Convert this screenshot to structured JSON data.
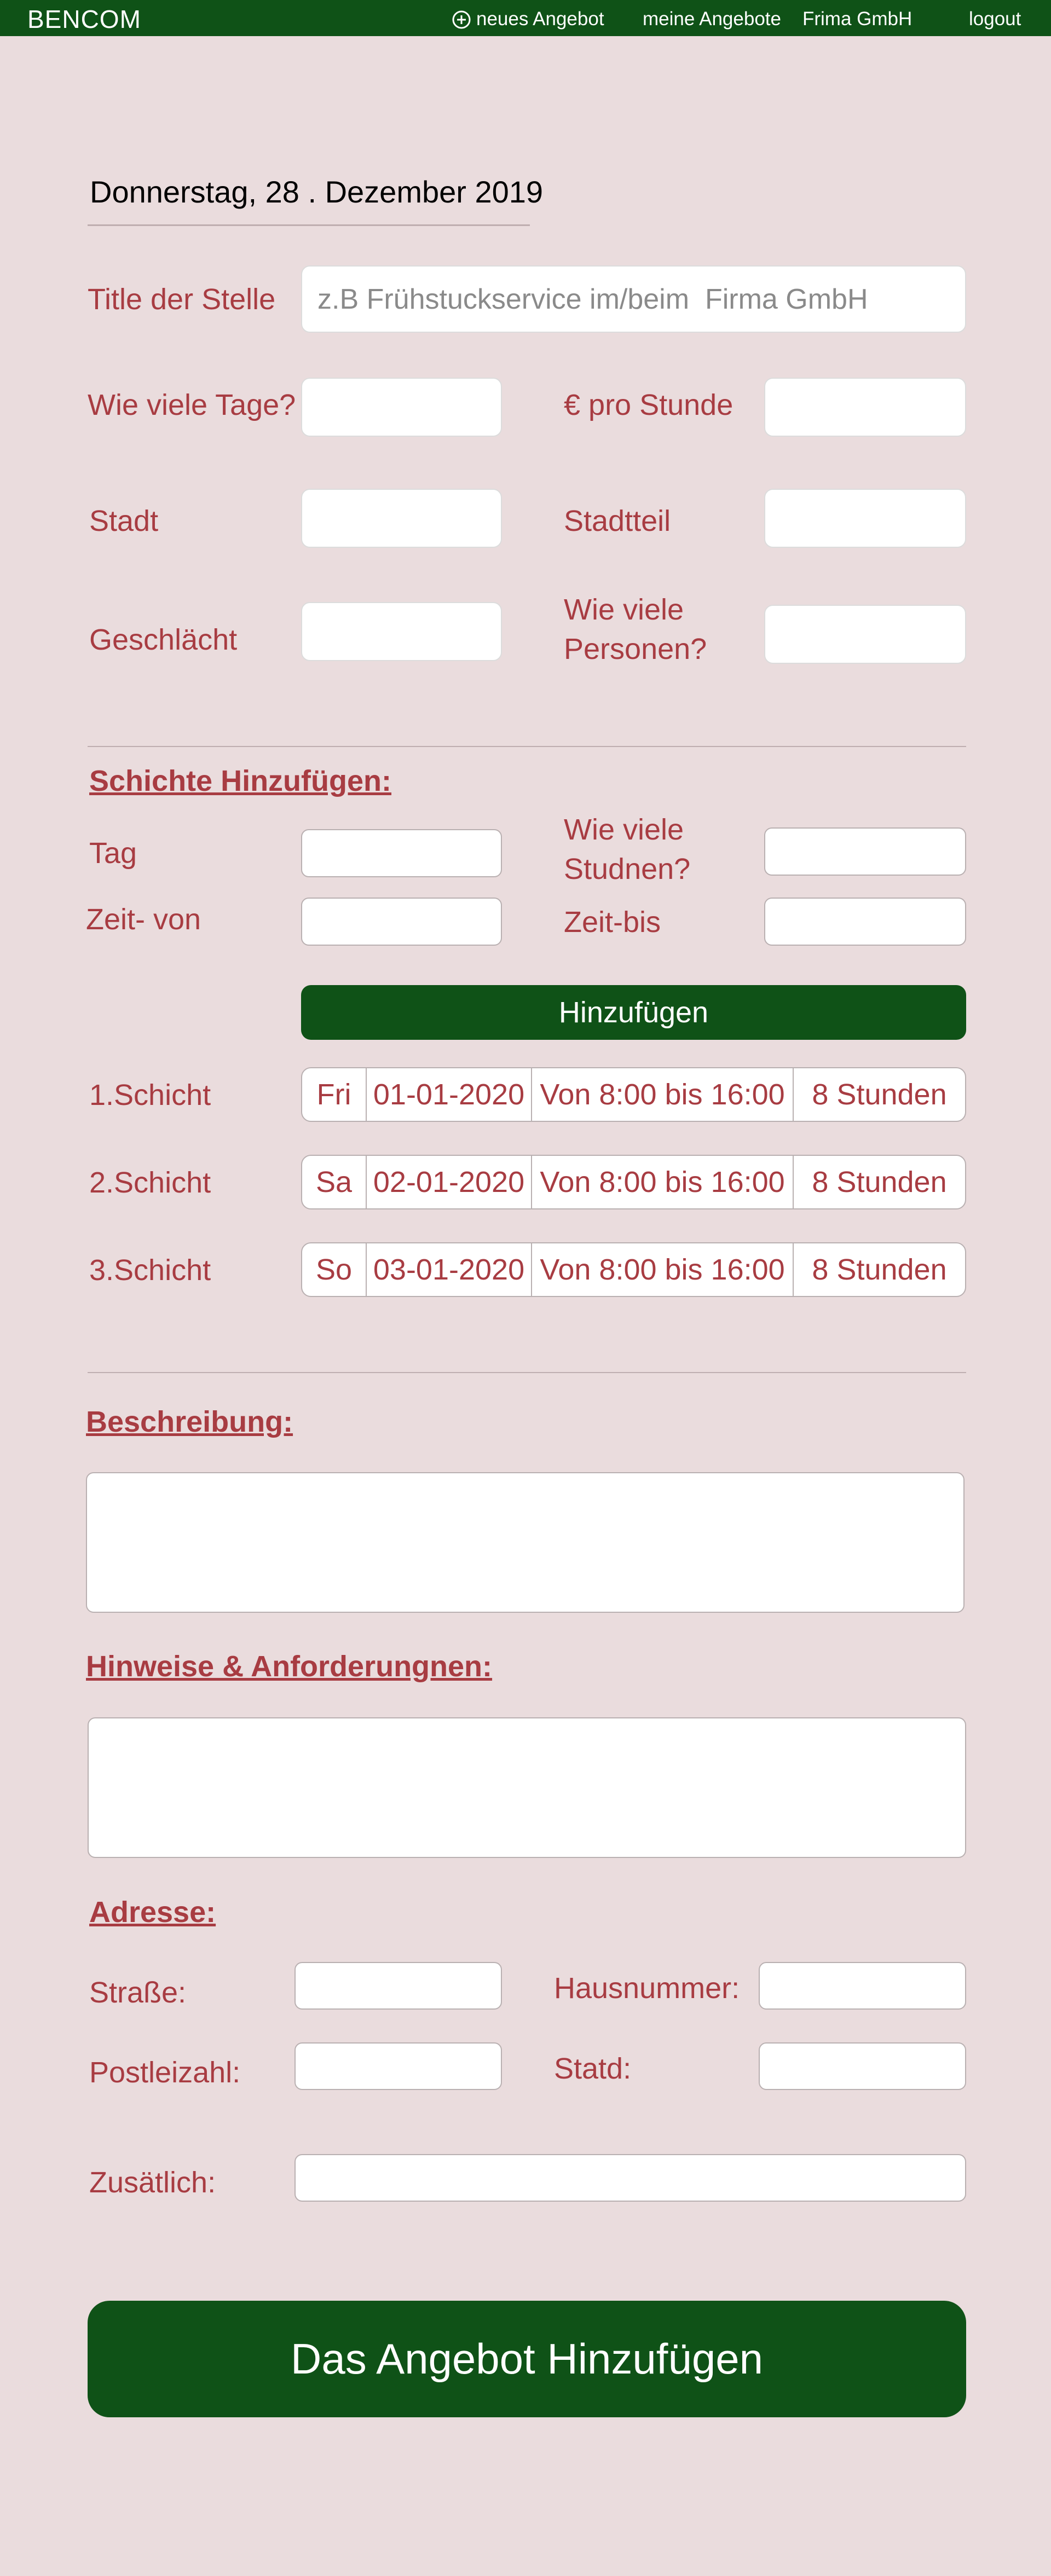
{
  "header": {
    "brand": "BENCOM",
    "nav": {
      "new_offer": "neues Angebot",
      "my_offers": "meine Angebote",
      "company": "Frima GmbH",
      "logout": "logout"
    }
  },
  "date": "Donnerstag, 28 . Dezember 2019",
  "form": {
    "title_label": "Title der Stelle",
    "title_placeholder": "z.B Frühstuckservice im/beim  Firma GmbH",
    "days_label": "Wie viele Tage?",
    "rate_label": "€ pro Stunde",
    "city_label": "Stadt",
    "district_label": "Stadtteil",
    "gender_label": "Geschlächt",
    "persons_label": "Wie viele Personen?"
  },
  "shifts": {
    "section_title": "Schichte Hinzufügen:",
    "day_label": "Tag",
    "hours_label": "Wie viele Studnen?",
    "time_from_label": "Zeit- von",
    "time_to_label": "Zeit-bis",
    "add_button": "Hinzufügen",
    "rows": [
      {
        "label": "1.Schicht",
        "day": "Fri",
        "date": "01-01-2020",
        "time": "Von 8:00 bis 16:00",
        "hours": "8 Stunden"
      },
      {
        "label": "2.Schicht",
        "day": "Sa",
        "date": "02-01-2020",
        "time": "Von 8:00 bis 16:00",
        "hours": "8 Stunden"
      },
      {
        "label": "3.Schicht",
        "day": "So",
        "date": "03-01-2020",
        "time": "Von 8:00 bis 16:00",
        "hours": "8 Stunden"
      }
    ]
  },
  "description": {
    "title": "Beschreibung:"
  },
  "requirements": {
    "title": "Hinweise & Anforderungnen:"
  },
  "address": {
    "title": "Adresse:",
    "street_label": "Straße:",
    "house_number_label": "Hausnummer:",
    "postal_code_label": "Postleizahl:",
    "city_label": "Statd:",
    "additional_label": "Zusätlich:"
  },
  "submit_button": "Das Angebot Hinzufügen",
  "colors": {
    "background": "#eadcdd",
    "header_green": "#0f5217",
    "label_red": "#a83c42"
  }
}
